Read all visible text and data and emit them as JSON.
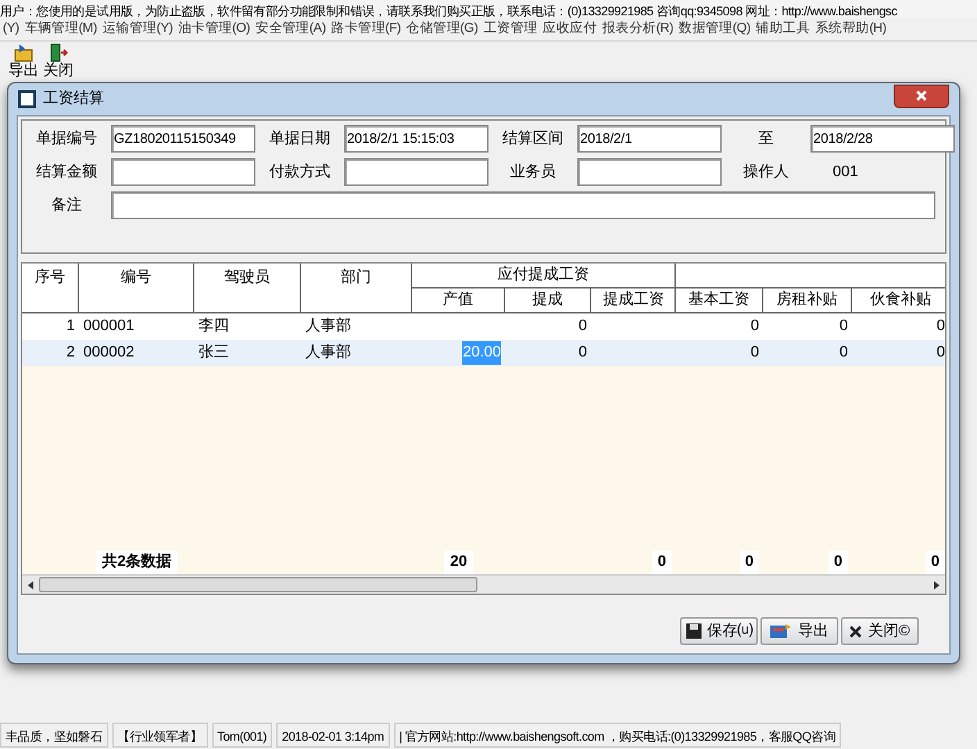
{
  "notice": "用户：您使用的是试用版，为防止盗版，软件留有部分功能限制和错误，请联系我们购买正版，联系电话：(0)13329921985  咨询qq:9345098   网址：http://www.baishengsc",
  "menu": [
    "(Y)",
    "车辆管理(M)",
    "运输管理(Y)",
    "油卡管理(O)",
    "安全管理(A)",
    "路卡管理(F)",
    "仓储管理(G)",
    "工资管理",
    "应收应付",
    "报表分析(R)",
    "数据管理(Q)",
    "辅助工具",
    "系统帮助(H)"
  ],
  "toolbar": [
    {
      "label": "导出",
      "kind": "export"
    },
    {
      "label": "关闭",
      "kind": "close"
    }
  ],
  "dialog": {
    "title": "工资结算",
    "form_rows": [
      [
        {
          "label": "单据编号",
          "value": "GZ18020115150349"
        },
        {
          "label": "单据日期",
          "value": "2018/2/1 15:15:03"
        },
        {
          "label": "结算区间",
          "value": "2018/2/1"
        },
        {
          "label": "至",
          "value": "2018/2/28"
        }
      ],
      [
        {
          "label": "结算金额"
        },
        {
          "label": "付款方式"
        },
        {
          "label": "业务员"
        },
        {
          "label": "操作人",
          "text": "001"
        }
      ]
    ],
    "remark_label": "备注",
    "grid": {
      "columns": [
        "序号",
        "编号",
        "驾驶员",
        "部门"
      ],
      "groups": [
        {
          "label": "应付提成工资",
          "columns": [
            "产值",
            "提成",
            "提成工资"
          ]
        },
        {
          "columns": [
            "基本工资",
            "房租补贴",
            "伙食补贴"
          ]
        }
      ],
      "rows": [
        {
          "selected": false,
          "cells": [
            "1",
            "000001",
            "李四",
            "人事部",
            null,
            "0",
            null,
            "0",
            "0",
            "0"
          ]
        },
        {
          "selected": true,
          "cells": [
            "2",
            "000002",
            "张三",
            "人事部",
            {
              "text": "20.00",
              "highlighted": true
            },
            "0",
            null,
            "0",
            "0",
            "0"
          ]
        }
      ],
      "summary": {
        "count_label": "共2条数据",
        "output_value": "20",
        "commission_wage": "0",
        "base_wage": "0",
        "rent_allowance": "0",
        "meal_allowance": "0"
      }
    },
    "buttons": [
      {
        "label": "保存⒰",
        "kind": "save"
      },
      {
        "label": "导出",
        "kind": "export"
      },
      {
        "label": "关闭©",
        "kind": "close"
      }
    ]
  },
  "status_bar": [
    "丰品质，坚如磐石",
    "【行业领军者】",
    "Tom(001)",
    "2018-02-01 3:14pm",
    "|  官方网站:http://www.baishengsoft.com ，购买电话:(0)13329921985，客服QQ咨询"
  ]
}
